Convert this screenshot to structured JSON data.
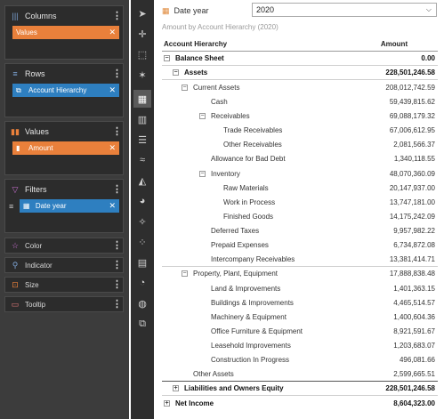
{
  "left_panel": {
    "columns": {
      "title": "Columns",
      "icon": "columns-icon",
      "pill": "Values",
      "pill_color": "#e9803b"
    },
    "rows": {
      "title": "Rows",
      "icon": "rows-icon",
      "pill": "Account Hierarchy",
      "pill_color": "#2e7fc0"
    },
    "values": {
      "title": "Values",
      "icon": "bar-chart-icon",
      "pill": "Amount",
      "pill_color": "#e9803b"
    },
    "filters": {
      "title": "Filters",
      "icon": "filter-icon",
      "pill": "Date year",
      "pill_color": "#2e7fc0"
    },
    "color": {
      "title": "Color",
      "icon": "star-icon"
    },
    "indicator": {
      "title": "Indicator",
      "icon": "indicator-icon"
    },
    "size": {
      "title": "Size",
      "icon": "size-icon"
    },
    "tooltip": {
      "title": "Tooltip",
      "icon": "tooltip-icon"
    }
  },
  "toolbar": {
    "items": [
      "pointer-icon",
      "move-icon",
      "select-region-icon",
      "magic-icon",
      "table-icon",
      "column-chart-icon",
      "bar-chart-icon",
      "line-chart-icon",
      "area-chart-icon",
      "pie-chart-icon",
      "radar-chart-icon",
      "scatter-chart-icon",
      "treemap-icon",
      "gauge-icon",
      "map-icon",
      "image-icon"
    ],
    "selected": "table-icon"
  },
  "filter": {
    "label": "Date year",
    "value": "2020"
  },
  "subtitle": "Amount by Account Hierarchy (2020)",
  "table": {
    "headers": {
      "account": "Account Hierarchy",
      "amount": "Amount"
    },
    "rows": [
      {
        "label": "Balance Sheet",
        "value": "0.00",
        "level": 0,
        "toggle": "−",
        "bold": true
      },
      {
        "label": "Assets",
        "value": "228,501,246.58",
        "level": 1,
        "toggle": "−",
        "bold": true
      },
      {
        "label": "Current Assets",
        "value": "208,012,742.59",
        "level": 2,
        "toggle": "−",
        "bold": false
      },
      {
        "label": "Cash",
        "value": "59,439,815.62",
        "level": 3,
        "toggle": "",
        "bold": false
      },
      {
        "label": "Receivables",
        "value": "69,088,179.32",
        "level": 3,
        "toggle": "−",
        "bold": false
      },
      {
        "label": "Trade Receivables",
        "value": "67,006,612.95",
        "level": 4,
        "toggle": "",
        "bold": false
      },
      {
        "label": "Other Receivables",
        "value": "2,081,566.37",
        "level": 4,
        "toggle": "",
        "bold": false
      },
      {
        "label": "Allowance for Bad Debt",
        "value": "1,340,118.55",
        "level": 3,
        "toggle": "",
        "bold": false
      },
      {
        "label": "Inventory",
        "value": "48,070,360.09",
        "level": 3,
        "toggle": "−",
        "bold": false
      },
      {
        "label": "Raw Materials",
        "value": "20,147,937.00",
        "level": 4,
        "toggle": "",
        "bold": false
      },
      {
        "label": "Work in Process",
        "value": "13,747,181.00",
        "level": 4,
        "toggle": "",
        "bold": false
      },
      {
        "label": "Finished Goods",
        "value": "14,175,242.09",
        "level": 4,
        "toggle": "",
        "bold": false
      },
      {
        "label": "Deferred Taxes",
        "value": "9,957,982.22",
        "level": 3,
        "toggle": "",
        "bold": false
      },
      {
        "label": "Prepaid Expenses",
        "value": "6,734,872.08",
        "level": 3,
        "toggle": "",
        "bold": false
      },
      {
        "label": "Intercompany Receivables",
        "value": "13,381,414.71",
        "level": 3,
        "toggle": "",
        "bold": false
      },
      {
        "label": "Property, Plant, Equipment",
        "value": "17,888,838.48",
        "level": 2,
        "toggle": "−",
        "bold": false
      },
      {
        "label": "Land & Improvements",
        "value": "1,401,363.15",
        "level": 3,
        "toggle": "",
        "bold": false
      },
      {
        "label": "Buildings & Improvements",
        "value": "4,465,514.57",
        "level": 3,
        "toggle": "",
        "bold": false
      },
      {
        "label": "Machinery & Equipment",
        "value": "1,400,604.36",
        "level": 3,
        "toggle": "",
        "bold": false
      },
      {
        "label": "Office Furniture & Equipment",
        "value": "8,921,591.67",
        "level": 3,
        "toggle": "",
        "bold": false
      },
      {
        "label": "Leasehold Improvements",
        "value": "1,203,683.07",
        "level": 3,
        "toggle": "",
        "bold": false
      },
      {
        "label": "Construction In Progress",
        "value": "496,081.66",
        "level": 3,
        "toggle": "",
        "bold": false
      },
      {
        "label": "Other Assets",
        "value": "2,599,665.51",
        "level": 2,
        "toggle": "",
        "bold": false
      },
      {
        "label": "Liabilities and Owners Equity",
        "value": "228,501,246.58",
        "level": 1,
        "toggle": "+",
        "bold": true
      },
      {
        "label": "Net Income",
        "value": "8,604,323.00",
        "level": 0,
        "toggle": "+",
        "bold": true
      }
    ]
  }
}
